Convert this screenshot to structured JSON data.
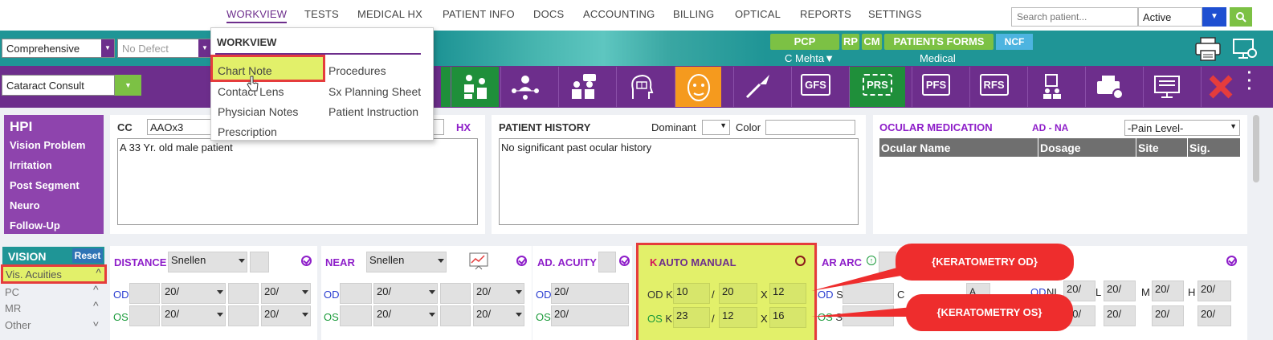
{
  "nav": {
    "items": [
      "WORKVIEW",
      "TESTS",
      "MEDICAL HX",
      "PATIENT INFO",
      "DOCS",
      "ACCOUNTING",
      "BILLING",
      "OPTICAL",
      "REPORTS",
      "SETTINGS"
    ],
    "search_placeholder": "Search patient...",
    "status": "Active"
  },
  "toolbar1": {
    "exam_type": "Comprehensive",
    "defect": "No Defect",
    "pcp": "PCP",
    "rp": "RP",
    "cm": "CM",
    "patients_forms": "PATIENTS FORMS",
    "ncf": "NCF",
    "doctor": "C Mehta▼",
    "plan": "Medical"
  },
  "toolbar2": {
    "visit_type": "Cataract Consult",
    "tools": [
      "GFS",
      "PRS",
      "PFS",
      "RFS"
    ]
  },
  "dropdown": {
    "title": "WORKVIEW",
    "col1": [
      "Chart Note",
      "Contact Lens",
      "Physician Notes",
      "Prescription"
    ],
    "col2": [
      "Procedures",
      "Sx Planning Sheet",
      "Patient Instruction"
    ]
  },
  "hpi": {
    "title": "HPI",
    "items": [
      "Vision Problem",
      "Irritation",
      "Post Segment",
      "Neuro",
      "Follow-Up"
    ]
  },
  "cc": {
    "label": "CC",
    "value": "AAOx3",
    "hx": "HX",
    "text": "A 33 Yr. old male patient"
  },
  "patient_history": {
    "label": "PATIENT HISTORY",
    "dominant": "Dominant",
    "color": "Color",
    "text": "No significant past ocular history"
  },
  "ocular_med": {
    "label": "OCULAR MEDICATION",
    "ad": "AD - NA",
    "pain": "-Pain Level-",
    "columns": [
      "Ocular Name",
      "Dosage",
      "Site",
      "Sig."
    ]
  },
  "vision": {
    "title": "VISION",
    "reset": "Reset",
    "items": [
      "Vis. Acuities",
      "PC",
      "MR",
      "Other"
    ]
  },
  "distance": {
    "label": "DISTANCE",
    "chart": "Snellen",
    "od_val": "20/",
    "os_val": "20/"
  },
  "near": {
    "label": "NEAR",
    "chart": "Snellen",
    "od_val": "20/",
    "os_val": "20/"
  },
  "ad_acuity": {
    "label": "AD. ACUITY",
    "od": "OD",
    "os": "OS",
    "od_val": "20/",
    "os_val": "20/"
  },
  "keratometry": {
    "k": "K",
    "label": "AUTO MANUAL",
    "od_k1": "10",
    "od_k2": "20",
    "od_x": "12",
    "os_k1": "23",
    "os_k2": "12",
    "os_x": "16"
  },
  "ar_arc": {
    "label": "AR ARC"
  },
  "right_block": {
    "nl": "NL",
    "l": "L",
    "m": "M",
    "h": "H",
    "val": "20/"
  },
  "callouts": {
    "od": "{KERATOMETRY OD}",
    "os": "{KERATOMETRY OS}"
  }
}
